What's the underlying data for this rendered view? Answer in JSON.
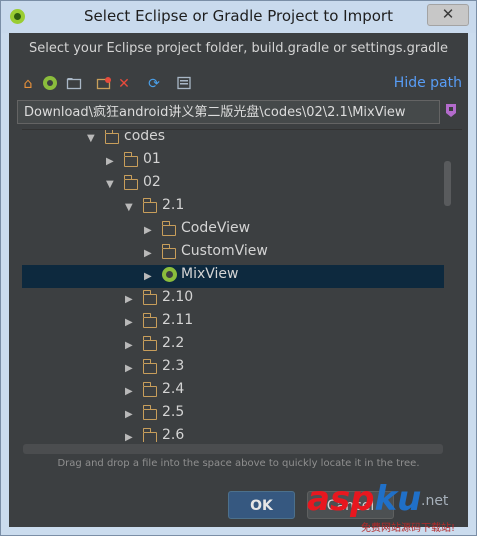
{
  "window": {
    "title": "Select Eclipse or Gradle Project to Import",
    "close_glyph": "✕"
  },
  "dialog": {
    "instruction": "Select your Eclipse project folder, build.gradle or settings.gradle",
    "toolbar": {
      "hide_path": "Hide path"
    },
    "path": "Download\\疯狂android讲义第二版光盘\\codes\\02\\2.1\\MixView",
    "tree": [
      {
        "label": "codes",
        "expanded": true,
        "type": "folder"
      },
      {
        "label": "01",
        "expanded": false,
        "type": "folder"
      },
      {
        "label": "02",
        "expanded": true,
        "type": "folder"
      },
      {
        "label": "2.1",
        "expanded": true,
        "type": "folder"
      },
      {
        "label": "CodeView",
        "expanded": false,
        "type": "folder"
      },
      {
        "label": "CustomView",
        "expanded": false,
        "type": "folder"
      },
      {
        "label": "MixView",
        "expanded": false,
        "type": "module",
        "selected": true
      },
      {
        "label": "2.10",
        "expanded": false,
        "type": "folder"
      },
      {
        "label": "2.11",
        "expanded": false,
        "type": "folder"
      },
      {
        "label": "2.2",
        "expanded": false,
        "type": "folder"
      },
      {
        "label": "2.3",
        "expanded": false,
        "type": "folder"
      },
      {
        "label": "2.4",
        "expanded": false,
        "type": "folder"
      },
      {
        "label": "2.5",
        "expanded": false,
        "type": "folder"
      },
      {
        "label": "2.6",
        "expanded": false,
        "type": "folder"
      }
    ],
    "hint": "Drag and drop a file into the space above to quickly locate it in the tree.",
    "ok_label": "OK",
    "cancel_label": "Cancel"
  },
  "watermark": {
    "asp": "asp",
    "ku": "ku",
    "net": ".net",
    "sub": "免费网站源码下载站!"
  },
  "colors": {
    "accent": "#589df6",
    "selection": "#0d293e",
    "panel": "#3c3f41",
    "folder": "#c89e5b",
    "module": "#8bbd3c"
  },
  "icons": [
    "home-icon",
    "android-module-icon",
    "new-folder-icon",
    "refresh-folder-icon",
    "delete-icon",
    "sync-icon",
    "show-hidden-icon"
  ]
}
